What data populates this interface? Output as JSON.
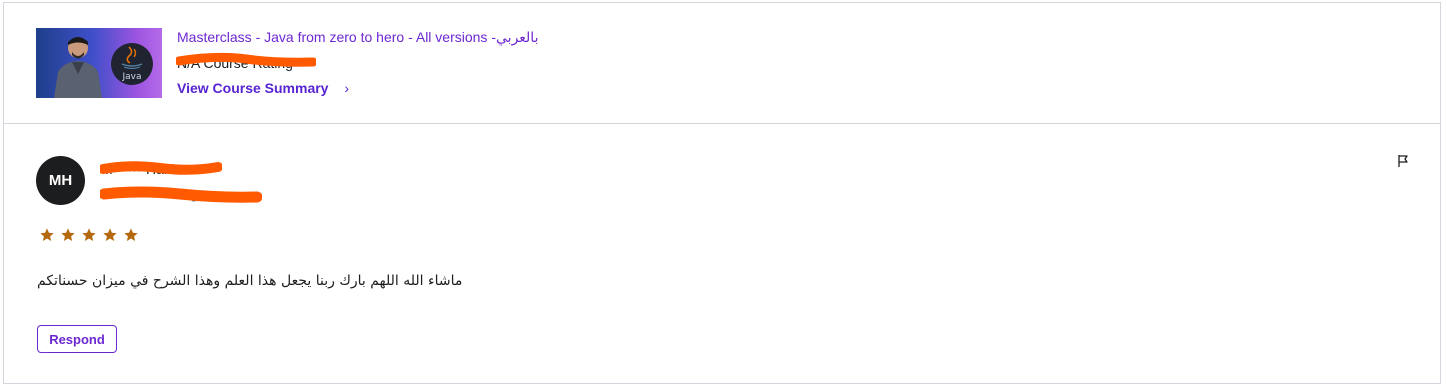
{
  "course": {
    "title": "Masterclass - Java from zero to hero - All versions -بالعربي",
    "rating_label": "N/A Course Rating",
    "view_summary": "View Course Summary",
    "thumbnail_badge": "Java",
    "icons": {
      "chevron": "chevron-right-icon",
      "java_logo": "java-logo-icon"
    }
  },
  "review": {
    "avatar_initials": "MH",
    "reviewer_name": "M•••••• Hakim",
    "meta": "U••••••••••••••••ago",
    "rating": 5,
    "rating_max": 5,
    "text": "ماشاء الله اللهم بارك ربنا يجعل هذا العلم وهذا الشرح في ميزان حسناتكم",
    "respond_label": "Respond",
    "flag_icon": "flag-icon"
  },
  "colors": {
    "accent": "#6d28d2",
    "star": "#b4690e",
    "redaction": "#ff5a00",
    "avatar_bg": "#1c1d1f",
    "border": "#d1d7dc"
  }
}
